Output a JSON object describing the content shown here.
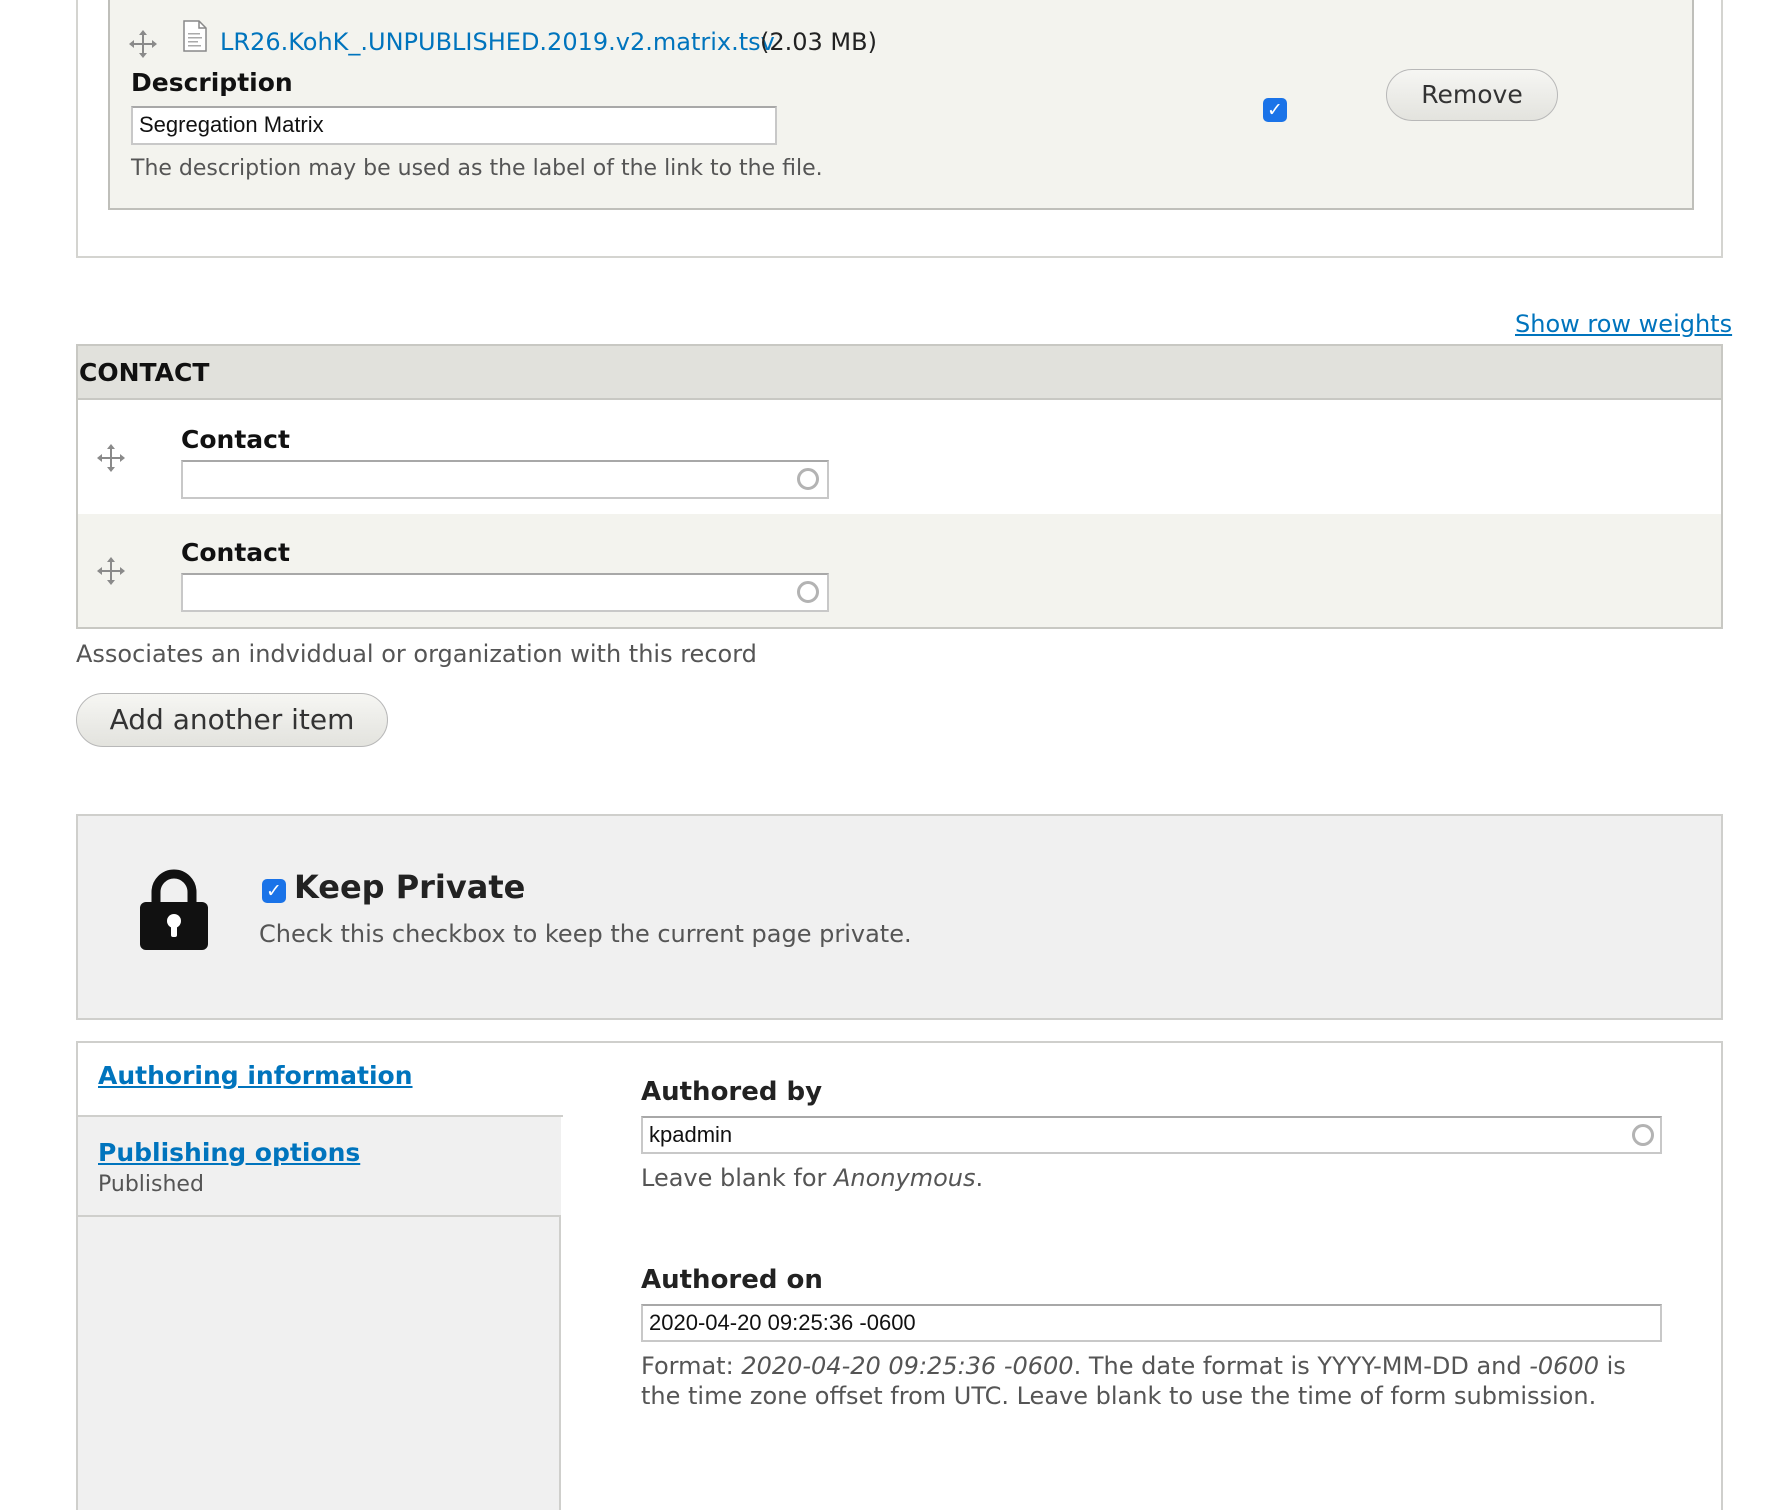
{
  "file_widget": {
    "file_name": "LR26.KohK_.UNPUBLISHED.2019.v2.matrix.tsv",
    "file_size": "(2.03 MB)",
    "description_label": "Description",
    "description_value": "Segregation Matrix",
    "description_help": "The description may be used as the label of the link to the file.",
    "display_checked": true,
    "remove_label": "Remove"
  },
  "show_row_weights": "Show row weights",
  "contact": {
    "header": "CONTACT",
    "rows": [
      {
        "label": "Contact",
        "value": ""
      },
      {
        "label": "Contact",
        "value": ""
      }
    ],
    "help": "Associates an indviddual or organization with this record",
    "add_button": "Add another item"
  },
  "keep_private": {
    "checked": true,
    "label": "Keep Private",
    "help": "Check this checkbox to keep the current page private."
  },
  "vertical_tabs": {
    "tabs": [
      {
        "title": "Authoring information",
        "summary": ""
      },
      {
        "title": "Publishing options",
        "summary": "Published"
      }
    ],
    "authored_by": {
      "label": "Authored by",
      "value": "kpadmin",
      "help_prefix": "Leave blank for ",
      "help_em": "Anonymous",
      "help_suffix": "."
    },
    "authored_on": {
      "label": "Authored on",
      "value": "2020-04-20 09:25:36 -0600",
      "help_line1_a": "Format: ",
      "help_line1_em1": "2020-04-20 09:25:36 -0600",
      "help_line1_b": ". The date format is YYYY-MM-DD and ",
      "help_line1_em2": "-0600",
      "help_line1_c": " is",
      "help_line2": "the time zone offset from UTC. Leave blank to use the time of form submission."
    }
  },
  "colors": {
    "link": "#0074bd",
    "checkbox": "#1a73e8",
    "panel_bg": "#f0f0f0",
    "row_bg": "#f3f3ee"
  }
}
